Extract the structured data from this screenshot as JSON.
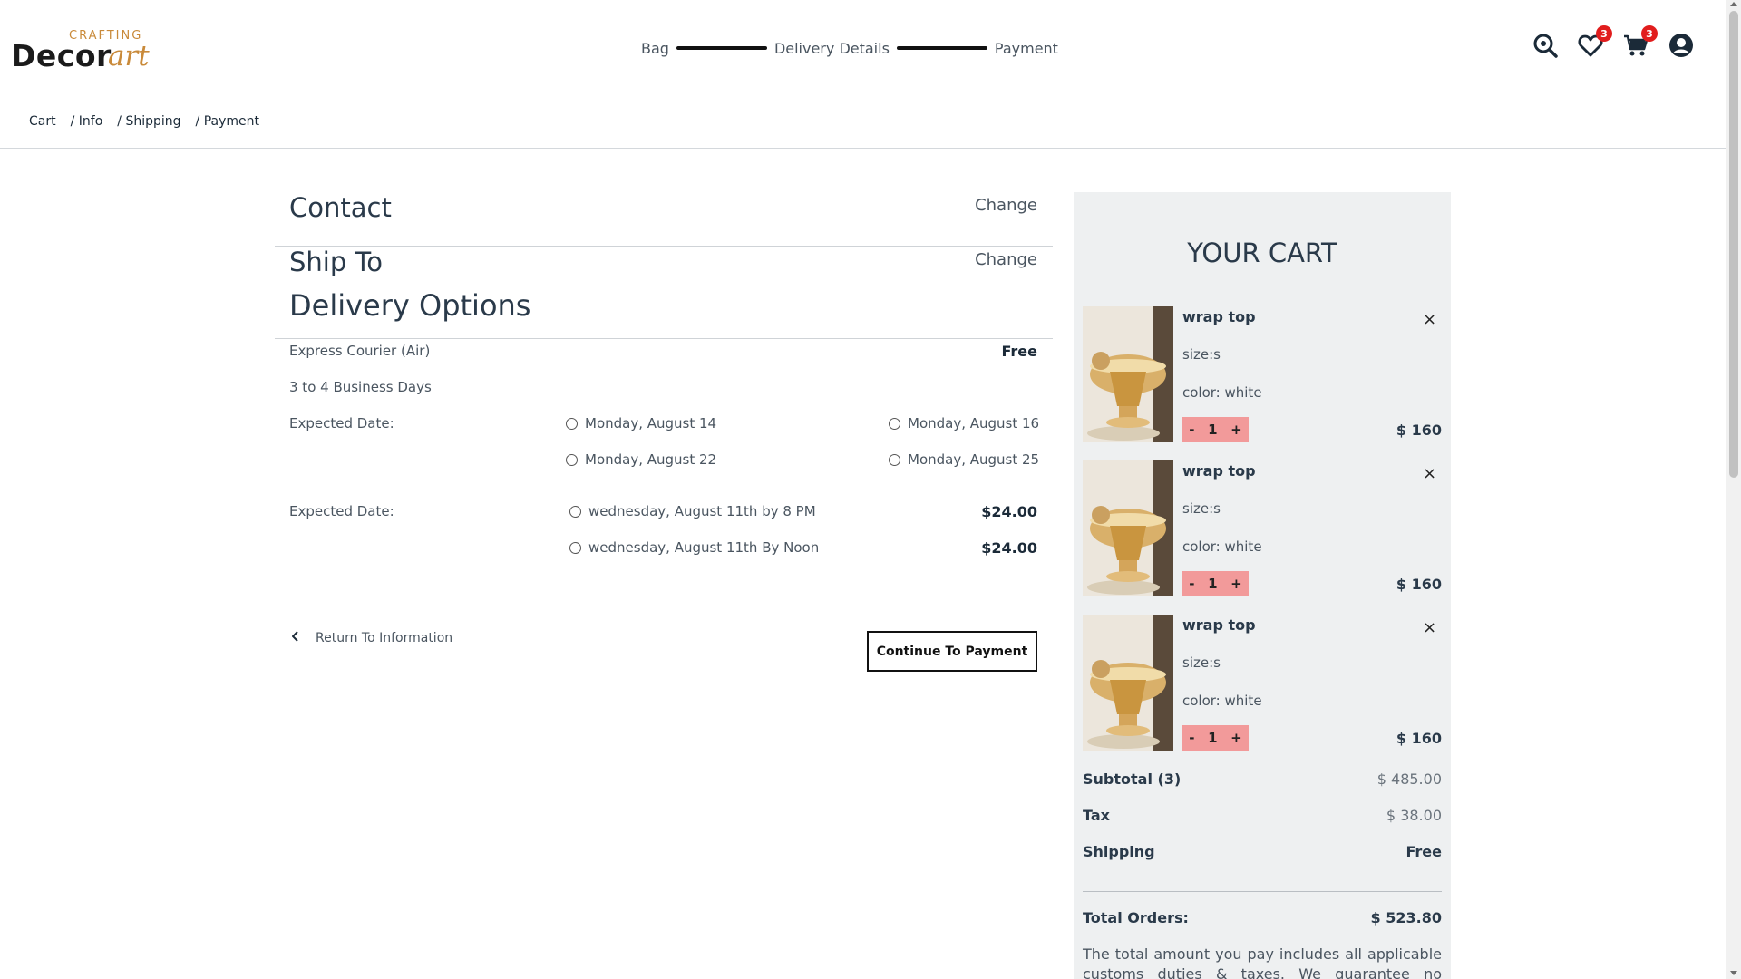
{
  "logo": {
    "small": "CRAFTING",
    "main": "Decor",
    "accent": "art"
  },
  "stepper": {
    "step1": "Bag",
    "step2": "Delivery Details",
    "step3": "Payment"
  },
  "header": {
    "wishlist_count": "3",
    "cart_count": "3",
    "badge_color": "#e11d1d"
  },
  "breadcrumb": {
    "cart": "Cart",
    "info": "/ Info",
    "shipping": "/ Shipping",
    "payment": "/ Payment"
  },
  "contact": {
    "title": "Contact",
    "change": "Change"
  },
  "ship_to": {
    "title": "Ship To",
    "change": "Change"
  },
  "delivery": {
    "title": "Delivery Options",
    "method": "Express Courier (Air)",
    "method_price": "Free",
    "duration": "3 to 4 Business Days",
    "expected_label": "Expected Date:",
    "dates": [
      "Monday, August 14",
      "Monday, August 16",
      "Monday, August 22",
      "Monday, August 25"
    ],
    "express_label": "Expected Date:",
    "express_options": [
      {
        "label": "wednesday, August 11th by 8 PM",
        "price": "$24.00"
      },
      {
        "label": "wednesday, August 11th By Noon",
        "price": "$24.00"
      }
    ]
  },
  "actions": {
    "return": "Return To Information",
    "continue": "Continue To Payment"
  },
  "cart": {
    "title": "YOUR CART",
    "items": [
      {
        "name": "wrap top",
        "size": "size:s",
        "color": "color: white",
        "qty": "1",
        "minus": "-",
        "plus": "+",
        "price": "$ 160",
        "remove": "×"
      },
      {
        "name": "wrap top",
        "size": "size:s",
        "color": "color: white",
        "qty": "1",
        "minus": "-",
        "plus": "+",
        "price": "$ 160",
        "remove": "×"
      },
      {
        "name": "wrap top",
        "size": "size:s",
        "color": "color: white",
        "qty": "1",
        "minus": "-",
        "plus": "+",
        "price": "$ 160",
        "remove": "×"
      }
    ],
    "subtotal_label": "Subtotal (3)",
    "subtotal": "$ 485.00",
    "tax_label": "Tax",
    "tax": "$ 38.00",
    "shipping_label": "Shipping",
    "shipping": "Free",
    "total_label": "Total Orders:",
    "total": "$ 523.80",
    "note": "The total amount you pay includes all applicable customs duties & taxes. We guarantee no additional"
  },
  "colors": {
    "accent": "#c98a3a",
    "qty_bg": "#f29a9a",
    "panel_bg": "#eef0f1"
  }
}
